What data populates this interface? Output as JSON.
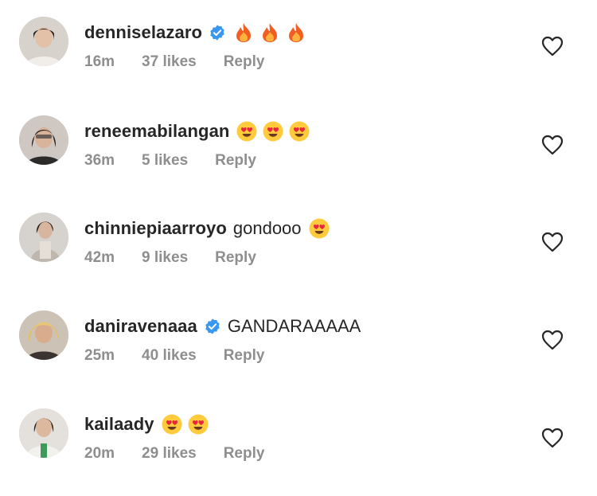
{
  "comments": [
    {
      "username": "denniselazaro",
      "verified": true,
      "text": "",
      "emojis": [
        "fire",
        "fire",
        "fire"
      ],
      "time": "16m",
      "likes": "37 likes",
      "reply": "Reply"
    },
    {
      "username": "reneemabilangan",
      "verified": false,
      "text": "",
      "emojis": [
        "heart-eyes",
        "heart-eyes",
        "heart-eyes"
      ],
      "time": "36m",
      "likes": "5 likes",
      "reply": "Reply"
    },
    {
      "username": "chinniepiaarroyo",
      "verified": false,
      "text": "gondooo",
      "emojis": [
        "heart-eyes"
      ],
      "time": "42m",
      "likes": "9 likes",
      "reply": "Reply"
    },
    {
      "username": "daniravenaaa",
      "verified": true,
      "text": "GANDARAAAAA",
      "emojis": [],
      "time": "25m",
      "likes": "40 likes",
      "reply": "Reply"
    },
    {
      "username": "kailaady",
      "verified": false,
      "text": "",
      "emojis": [
        "heart-eyes",
        "heart-eyes"
      ],
      "time": "20m",
      "likes": "29 likes",
      "reply": "Reply"
    }
  ],
  "colors": {
    "username": "#262626",
    "meta": "#8e8e8e",
    "verified": "#3897f0",
    "heart_outline": "#262626"
  },
  "icons": {
    "like": "heart-outline-icon",
    "verified": "verified-badge-icon"
  }
}
